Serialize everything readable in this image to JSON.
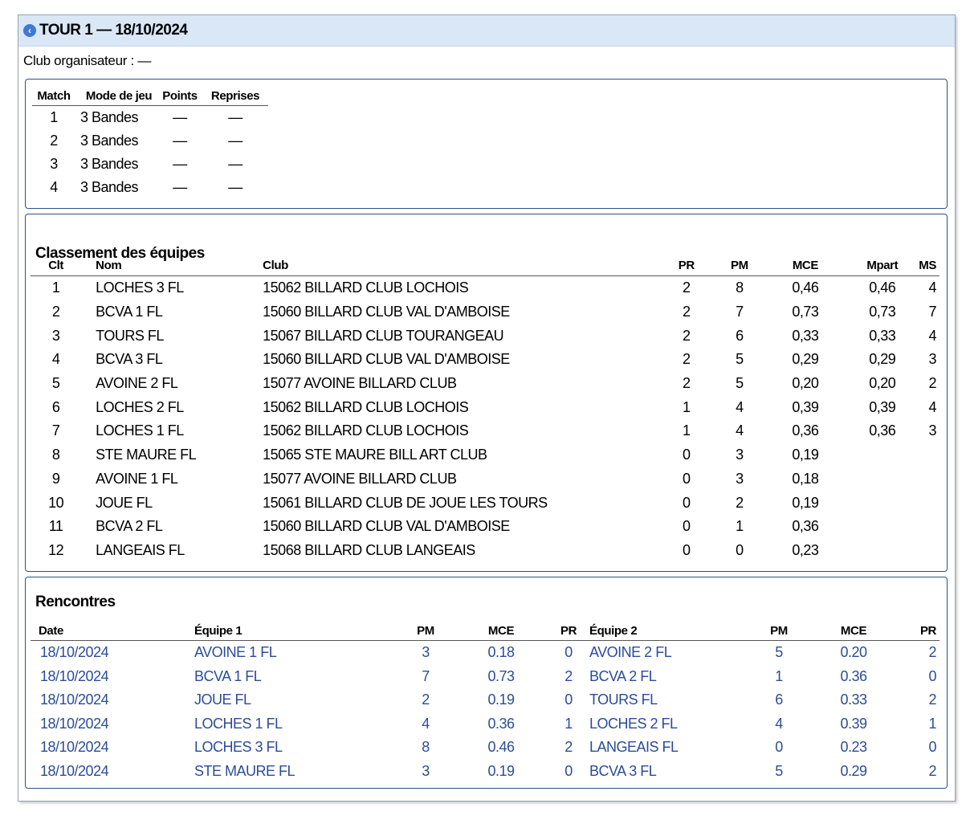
{
  "header": {
    "title": "TOUR 1 — 18/10/2024",
    "organizer": "Club organisateur : —"
  },
  "matches": {
    "columns": [
      "Match",
      "Mode de jeu",
      "Points",
      "Reprises"
    ],
    "rows": [
      [
        "1",
        "3 Bandes",
        "—",
        "—"
      ],
      [
        "2",
        "3 Bandes",
        "—",
        "—"
      ],
      [
        "3",
        "3 Bandes",
        "—",
        "—"
      ],
      [
        "4",
        "3 Bandes",
        "—",
        "—"
      ]
    ]
  },
  "ranking": {
    "title": "Classement des équipes",
    "columns": [
      "Clt",
      "Nom",
      "Club",
      "PR",
      "PM",
      "MCE",
      "Mpart",
      "MS"
    ],
    "rows": [
      [
        "1",
        "LOCHES 3 FL",
        "15062 BILLARD CLUB LOCHOIS",
        "2",
        "8",
        "0,46",
        "0,46",
        "4"
      ],
      [
        "2",
        "BCVA 1 FL",
        "15060 BILLARD CLUB VAL D'AMBOISE",
        "2",
        "7",
        "0,73",
        "0,73",
        "7"
      ],
      [
        "3",
        "TOURS FL",
        "15067 BILLARD CLUB TOURANGEAU",
        "2",
        "6",
        "0,33",
        "0,33",
        "4"
      ],
      [
        "4",
        "BCVA 3 FL",
        "15060 BILLARD CLUB VAL D'AMBOISE",
        "2",
        "5",
        "0,29",
        "0,29",
        "3"
      ],
      [
        "5",
        "AVOINE 2 FL",
        "15077 AVOINE BILLARD CLUB",
        "2",
        "5",
        "0,20",
        "0,20",
        "2"
      ],
      [
        "6",
        "LOCHES 2 FL",
        "15062 BILLARD CLUB LOCHOIS",
        "1",
        "4",
        "0,39",
        "0,39",
        "4"
      ],
      [
        "7",
        "LOCHES 1 FL",
        "15062 BILLARD CLUB LOCHOIS",
        "1",
        "4",
        "0,36",
        "0,36",
        "3"
      ],
      [
        "8",
        "STE MAURE FL",
        "15065 STE MAURE BILL ART CLUB",
        "0",
        "3",
        "0,19",
        "",
        ""
      ],
      [
        "9",
        "AVOINE 1 FL",
        "15077 AVOINE BILLARD CLUB",
        "0",
        "3",
        "0,18",
        "",
        ""
      ],
      [
        "10",
        "JOUE FL",
        "15061 BILLARD CLUB DE JOUE LES TOURS",
        "0",
        "2",
        "0,19",
        "",
        ""
      ],
      [
        "11",
        "BCVA 2 FL",
        "15060 BILLARD CLUB VAL D'AMBOISE",
        "0",
        "1",
        "0,36",
        "",
        ""
      ],
      [
        "12",
        "LANGEAIS FL",
        "15068 BILLARD CLUB LANGEAIS",
        "0",
        "0",
        "0,23",
        "",
        ""
      ]
    ]
  },
  "encounters": {
    "title": "Rencontres",
    "columns": [
      "Date",
      "Équipe 1",
      "PM",
      "MCE",
      "PR",
      "Équipe 2",
      "PM",
      "MCE",
      "PR"
    ],
    "rows": [
      [
        "18/10/2024",
        "AVOINE 1 FL",
        "3",
        "0.18",
        "0",
        "AVOINE 2 FL",
        "5",
        "0.20",
        "2"
      ],
      [
        "18/10/2024",
        "BCVA 1 FL",
        "7",
        "0.73",
        "2",
        "BCVA 2 FL",
        "1",
        "0.36",
        "0"
      ],
      [
        "18/10/2024",
        "JOUE FL",
        "2",
        "0.19",
        "0",
        "TOURS FL",
        "6",
        "0.33",
        "2"
      ],
      [
        "18/10/2024",
        "LOCHES 1 FL",
        "4",
        "0.36",
        "1",
        "LOCHES 2 FL",
        "4",
        "0.39",
        "1"
      ],
      [
        "18/10/2024",
        "LOCHES 3 FL",
        "8",
        "0.46",
        "2",
        "LANGEAIS FL",
        "0",
        "0.23",
        "0"
      ],
      [
        "18/10/2024",
        "STE MAURE FL",
        "3",
        "0.19",
        "0",
        "BCVA 3 FL",
        "5",
        "0.29",
        "2"
      ]
    ]
  },
  "colors": {
    "title_bar": "#d9e7f7",
    "panel_border": "#2f4f86",
    "link_text": "#2b4c9b"
  }
}
